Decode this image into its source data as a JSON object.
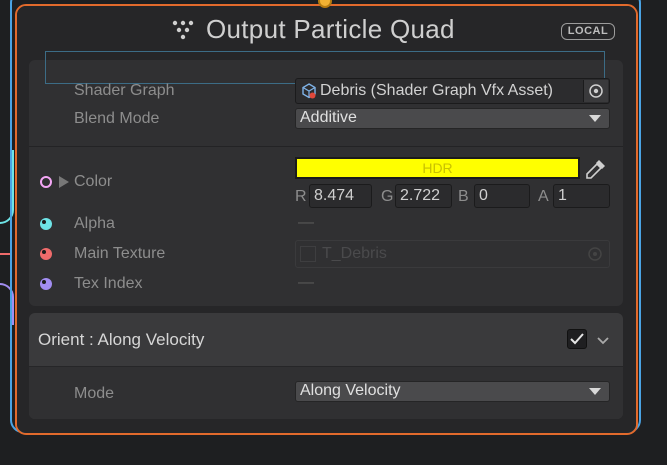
{
  "node": {
    "title": "Output Particle Quad",
    "space_badge": "LOCAL",
    "title_icon": "vfx-output-icon"
  },
  "properties": {
    "shader_graph": {
      "label": "Shader Graph",
      "value": "Debris (Shader Graph Vfx Asset)",
      "icon": "shader-graph-asset-icon"
    },
    "blend_mode": {
      "label": "Blend Mode",
      "value": "Additive"
    }
  },
  "inputs": {
    "color": {
      "label": "Color",
      "hdr_label": "HDR",
      "swatch": "#ffff00",
      "r_label": "R",
      "r": "8.474",
      "g_label": "G",
      "g": "2.722",
      "b_label": "B",
      "b": "0",
      "a_label": "A",
      "a": "1",
      "port_color": "#f3a6f5"
    },
    "alpha": {
      "label": "Alpha",
      "value": "—",
      "port_color": "#6ee3e6"
    },
    "main_texture": {
      "label": "Main Texture",
      "value": "T_Debris",
      "port_color": "#ef6b6b"
    },
    "tex_index": {
      "label": "Tex Index",
      "value": "—",
      "port_color": "#a28df2"
    }
  },
  "orient_block": {
    "title": "Orient : Along Velocity",
    "enabled": true,
    "mode_label": "Mode",
    "mode_value": "Along Velocity"
  }
}
